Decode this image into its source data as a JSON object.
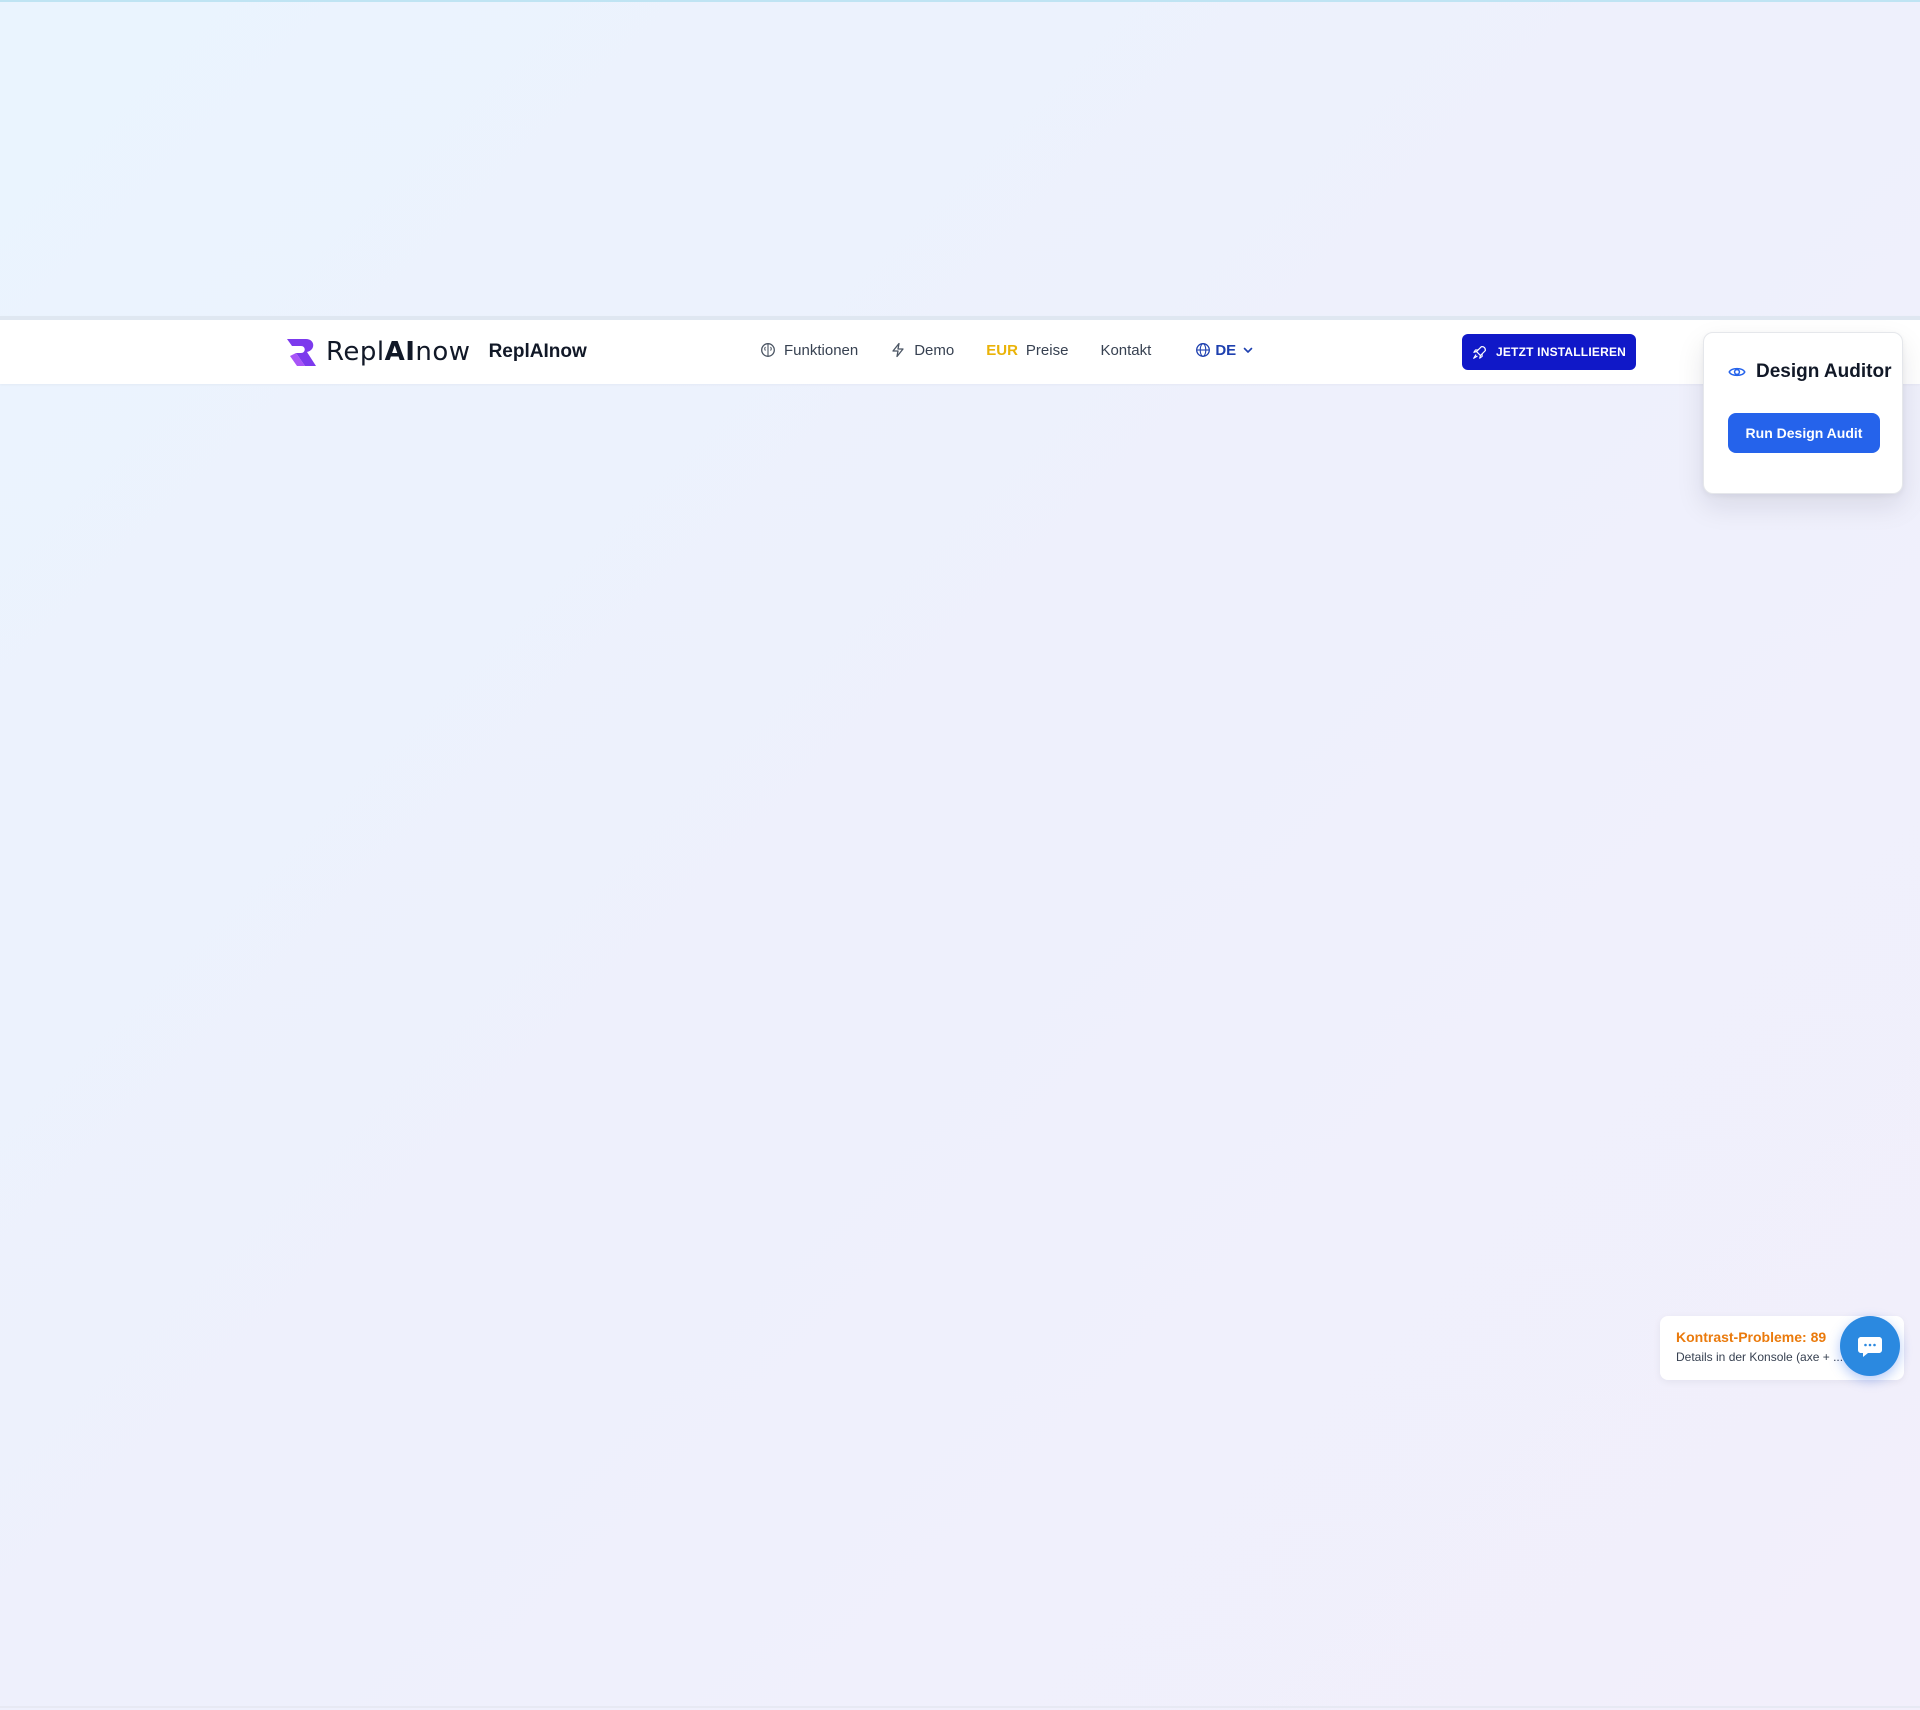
{
  "brand": {
    "logo_text_regular_a": "Repl",
    "logo_text_bold": "AI",
    "logo_text_regular_b": "now",
    "name": "ReplAInow"
  },
  "nav": {
    "links": [
      {
        "label": "Funktionen",
        "icon": "brain-icon"
      },
      {
        "label": "Demo",
        "icon": "lightning-icon"
      },
      {
        "label": "Preise",
        "prefix": "EUR"
      },
      {
        "label": "Kontakt"
      }
    ],
    "language": {
      "label": "DE",
      "icon": "globe-icon"
    }
  },
  "cta": {
    "install_label": "JETZT INSTALLIEREN",
    "icon": "rocket-icon"
  },
  "auditor": {
    "title": "Design Auditor",
    "icon": "eye-icon",
    "button_label": "Run Design Audit"
  },
  "contrast": {
    "title": "Kontrast-Probleme: 89",
    "detail": "Details in der Konsole (axe + ..."
  },
  "chat": {
    "icon": "chat-bubble-icon"
  },
  "colors": {
    "cta_bg": "#1018c8",
    "audit_btn_bg": "#2563eb",
    "warning": "#ea7a0c",
    "eur": "#eab308",
    "chat_bg": "#2b89e0",
    "brand_purple": "#7c3aed"
  }
}
